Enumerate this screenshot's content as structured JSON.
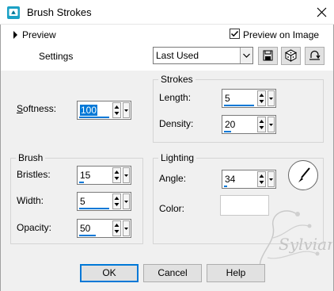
{
  "window": {
    "title": "Brush Strokes"
  },
  "preview": {
    "label": "Preview",
    "preview_on_image_label": "Preview on Image",
    "preview_on_image_checked": true
  },
  "settings": {
    "label": "Settings",
    "preset_value": "Last Used"
  },
  "softness": {
    "label": "Softness:",
    "value": "100"
  },
  "strokes": {
    "title": "Strokes",
    "length_label": "Length:",
    "length_value": "5",
    "density_label": "Density:",
    "density_value": "20"
  },
  "brush": {
    "title": "Brush",
    "bristles_label": "Bristles:",
    "bristles_value": "15",
    "width_label": "Width:",
    "width_value": "5",
    "opacity_label": "Opacity:",
    "opacity_value": "50"
  },
  "lighting": {
    "title": "Lighting",
    "angle_label": "Angle:",
    "angle_value": "34",
    "color_label": "Color:",
    "color_value": "#ffffff"
  },
  "buttons": {
    "ok": "OK",
    "cancel": "Cancel",
    "help": "Help"
  },
  "watermark": {
    "text": "Sylvian"
  },
  "colors": {
    "accent": "#0078d7",
    "dialog_bg": "#f0f0f0",
    "icon_teal": "#1ba1c5"
  },
  "icons": [
    "brush-strokes-app-icon",
    "close-icon",
    "expand-arrow-icon",
    "checkbox-checked-icon",
    "dropdown-arrow-icon",
    "save-preset-icon",
    "randomize-icon",
    "reset-icon",
    "spin-updown-icon",
    "angle-dial-icon"
  ]
}
